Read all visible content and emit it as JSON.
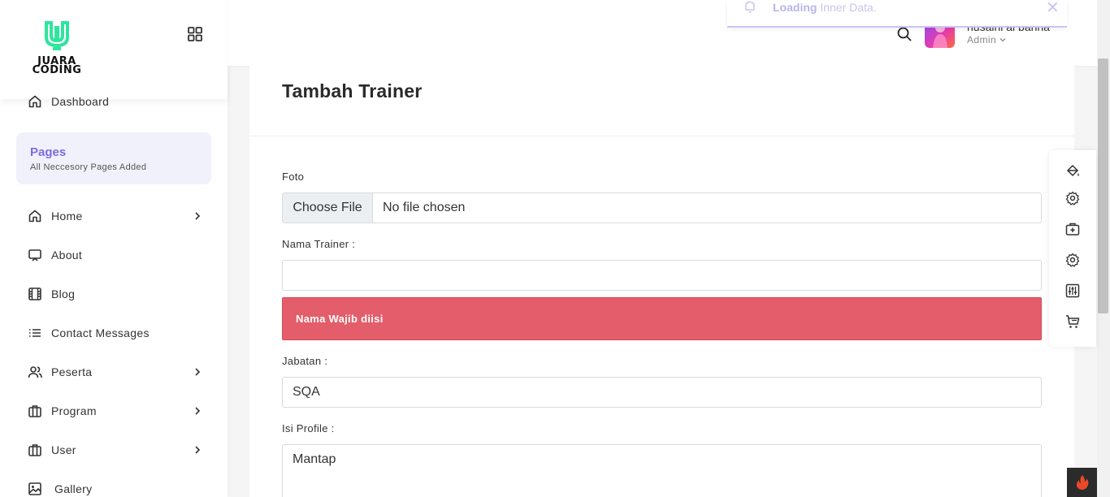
{
  "brand": {
    "line1": "JUARA",
    "line2": "CODING",
    "accent": "#2ee59d"
  },
  "sidebar": {
    "items": [
      {
        "label": "Dashboard",
        "icon": "home-icon"
      },
      {
        "label": "Home",
        "icon": "home-icon"
      },
      {
        "label": "About",
        "icon": "monitor-icon"
      },
      {
        "label": "Blog",
        "icon": "film-icon"
      },
      {
        "label": "Contact Messages",
        "icon": "list-icon"
      },
      {
        "label": "Peserta",
        "icon": "users-icon"
      },
      {
        "label": "Program",
        "icon": "briefcase-icon"
      },
      {
        "label": "User",
        "icon": "briefcase-icon"
      },
      {
        "label": "Gallery",
        "icon": "image-icon"
      }
    ],
    "pages_box": {
      "title": "Pages",
      "subtitle": "All Neccesory Pages Added",
      "title_color": "#7b6be3"
    }
  },
  "header": {
    "user_name": "husaini al banna",
    "user_role": "Admin",
    "toast": {
      "strong": "Loading",
      "rest": " Inner Data.",
      "close": "✕"
    }
  },
  "form": {
    "title": "Tambah Trainer",
    "foto_label": "Foto",
    "file_button": "Choose File",
    "file_status": "No file chosen",
    "nama_label": "Nama Trainer :",
    "nama_value": "",
    "error_message": "Nama Wajib diisi",
    "error_color": "#e35d6a",
    "jabatan_label": "Jabatan :",
    "jabatan_value": "SQA",
    "profile_label": "Isi Profile :",
    "profile_value": "Mantap"
  },
  "right_toolbar": {
    "icons": [
      "paint-bucket-icon",
      "gear-icon",
      "medical-case-icon",
      "gear-icon",
      "equalizer-icon",
      "cart-icon"
    ]
  }
}
